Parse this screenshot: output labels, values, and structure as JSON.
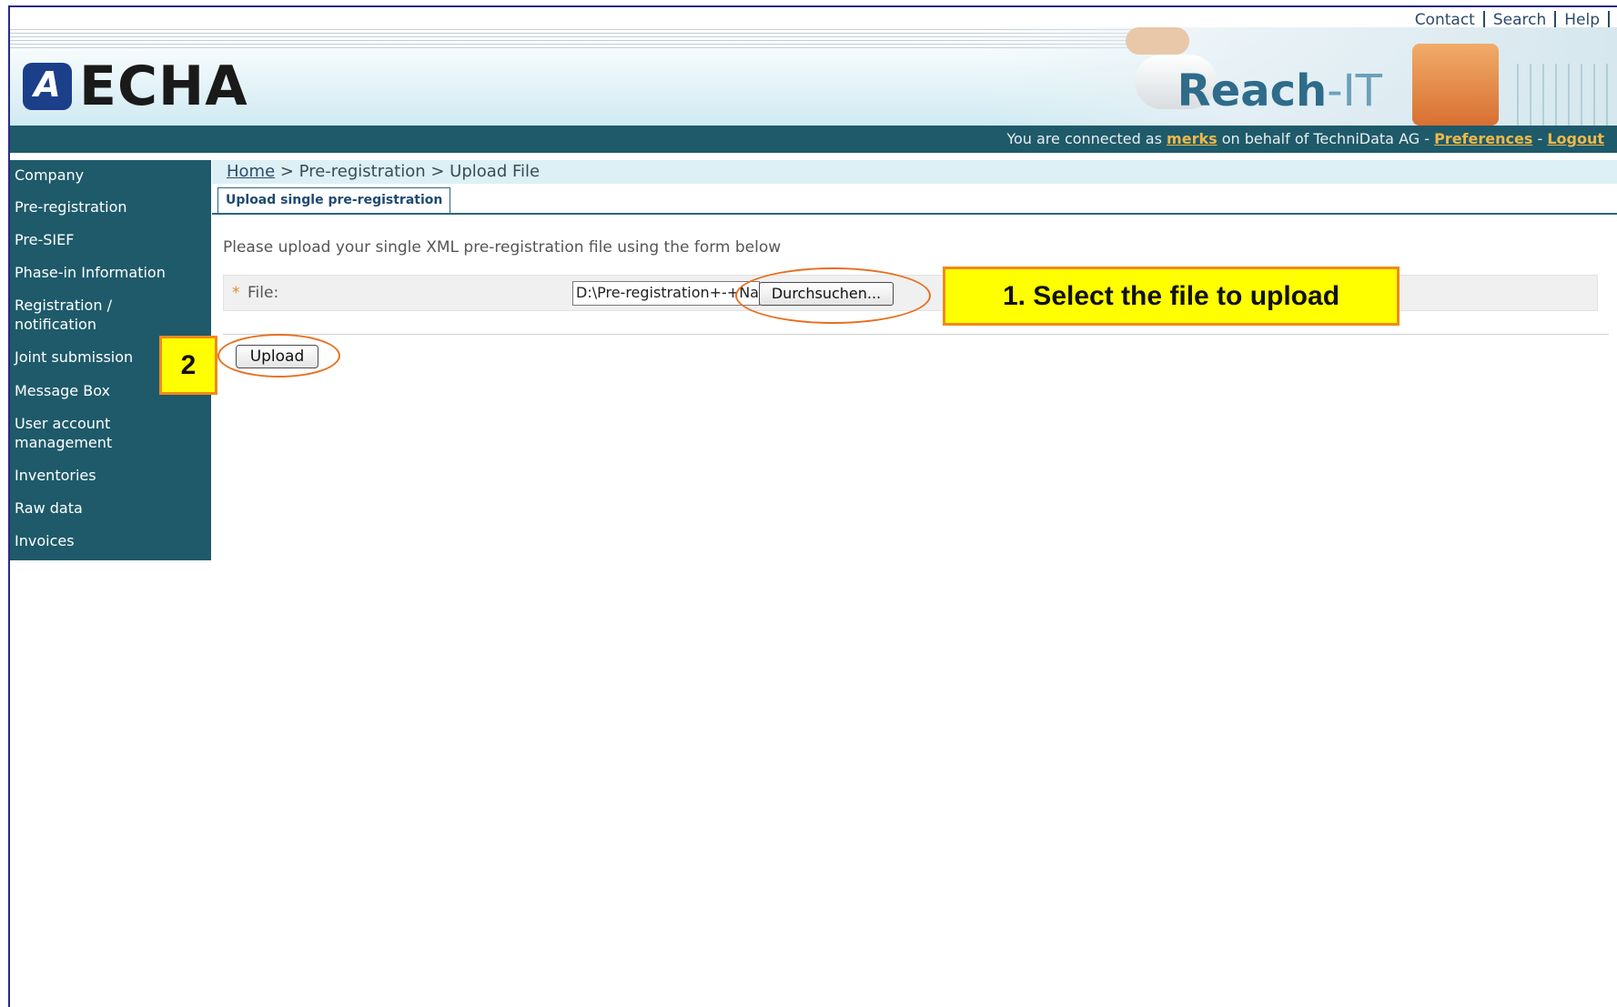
{
  "top_links": [
    "Contact",
    "Search",
    "Help"
  ],
  "header": {
    "logo_text": "ECHA",
    "brand_name": "Reach",
    "brand_suffix": "-IT"
  },
  "connection": {
    "prefix": "You are connected as",
    "user": "merks",
    "middle": "on behalf of TechniData AG -",
    "preferences": "Preferences",
    "dash": "-",
    "logout": "Logout"
  },
  "sidebar": {
    "items": [
      {
        "label": "Company"
      },
      {
        "label": "Pre-registration"
      },
      {
        "label": "Pre-SIEF"
      },
      {
        "label": "Phase-in Information"
      },
      {
        "label": "Registration /\nnotification"
      },
      {
        "label": "Joint submission"
      },
      {
        "label": "Message Box"
      },
      {
        "label": "User account\nmanagement"
      },
      {
        "label": "Inventories"
      },
      {
        "label": "Raw data"
      },
      {
        "label": "Invoices"
      }
    ]
  },
  "breadcrumb": {
    "home": "Home",
    "rest": " > Pre-registration > Upload File"
  },
  "tab": {
    "label": "Upload single pre-registration"
  },
  "form": {
    "instructions": "Please upload your single XML pre-registration file using the form below",
    "required_mark": "*",
    "file_label": "File:",
    "file_value": "D:\\Pre-registration+-+Na",
    "browse_label": "Durchsuchen...",
    "upload_label": "Upload"
  },
  "annotations": {
    "step1": "1. Select the file to upload",
    "step2": "2"
  },
  "colors": {
    "sidebar_bg": "#1e5a6a",
    "callout_bg": "#ffff00",
    "callout_border": "#f08a1c",
    "oval": "#e8701e",
    "link_highlight": "#f0b848"
  }
}
